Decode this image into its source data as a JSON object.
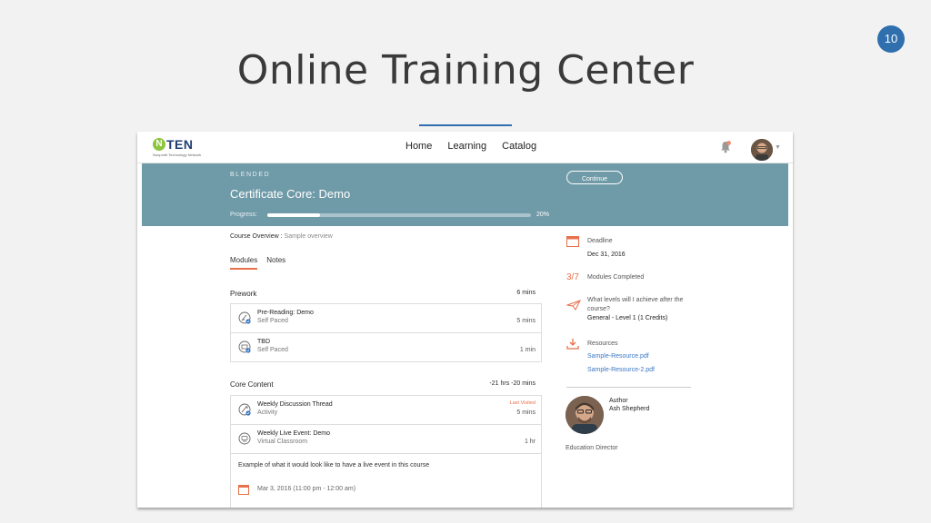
{
  "slide": {
    "title": "Online Training Center",
    "number": "10",
    "accent_color": "#2f6fae"
  },
  "nav": {
    "logo_letter": "N",
    "logo_text": "TEN",
    "logo_subtitle": "Nonprofit Technology Network",
    "links": [
      "Home",
      "Learning",
      "Catalog"
    ],
    "notification_count": "0"
  },
  "course": {
    "type": "BLENDED",
    "title": "Certificate Core: Demo",
    "continue_label": "Continue",
    "progress_label": "Progress:",
    "progress_percent": 20,
    "progress_text": "20%",
    "banner_color": "#6f9aa8"
  },
  "overview": {
    "label": "Course Overview :",
    "value": "Sample overview"
  },
  "tabs": [
    "Modules",
    "Notes"
  ],
  "sections": [
    {
      "name": "Prework",
      "duration": "6 mins",
      "items": [
        {
          "title": "Pre-Reading: Demo",
          "subtitle": "Self Paced",
          "duration": "5 mins",
          "icon": "reading-icon"
        },
        {
          "title": "TBD",
          "subtitle": "Self Paced",
          "duration": "1 min",
          "icon": "certificate-icon"
        }
      ]
    },
    {
      "name": "Core Content",
      "duration": "-21 hrs -20 mins",
      "items": [
        {
          "title": "Weekly Discussion Thread",
          "subtitle": "Activity",
          "duration": "5 mins",
          "icon": "discussion-icon",
          "badge": "Last Visited"
        },
        {
          "title": "Weekly Live Event: Demo",
          "subtitle": "Virtual Classroom",
          "duration": "1 hr",
          "icon": "classroom-icon"
        }
      ],
      "event": {
        "description": "Example of what it would look like to have a live event in this course",
        "date": "Mar 3, 2016 (11:00 pm - 12:00 am)"
      }
    }
  ],
  "sidebar": {
    "deadline_label": "Deadline",
    "deadline_value": "Dec 31, 2016",
    "modules_count": "3/7",
    "modules_label": "Modules Completed",
    "levels_question": [
      "What levels will I achieve after the",
      "course?"
    ],
    "levels_value": "General - Level 1 (1 Credits)",
    "resources_label": "Resources",
    "resources": [
      "Sample-Resource.pdf",
      "Sample-Resource-2.pdf"
    ],
    "author_label": "Author",
    "author_name": "Ash Shepherd",
    "author_role": "Education Director",
    "accent_color": "#e8704a"
  }
}
